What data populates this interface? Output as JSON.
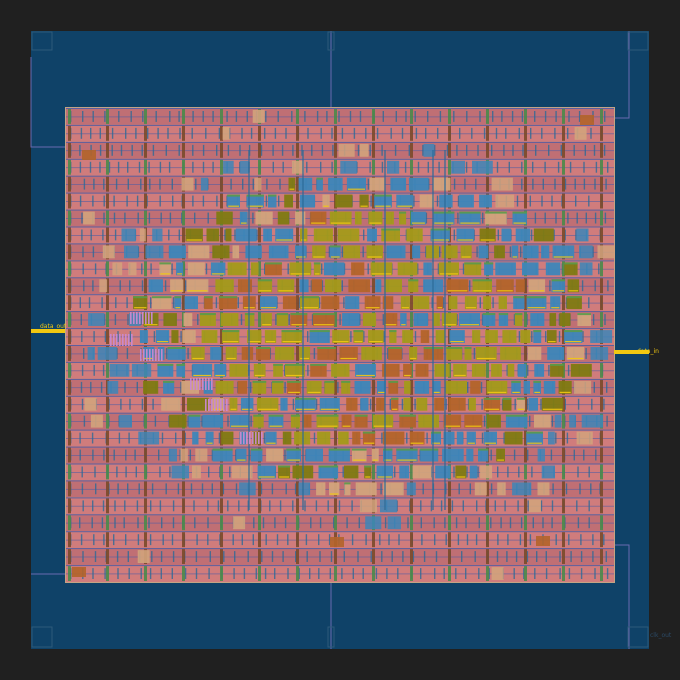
{
  "view": {
    "background": "#202020",
    "die_color": "#0f4268",
    "core_border": "#c4a484"
  },
  "colors": {
    "row_base": "#d07c7c",
    "row_base_alt": "#c06f74",
    "row_rail": "#5d5f9f",
    "metal_blue": "#3d86b9",
    "metal_blue_dark": "#2c6a97",
    "metal_olive": "#a39a1a",
    "metal_olive_dark": "#7f7a12",
    "metal_orange": "#b3642a",
    "metal_brown": "#7a4a2a",
    "metal_green": "#4a8a4a",
    "tan": "#d2a37c",
    "pink": "#c98ad0",
    "yellow": "#f2c811",
    "stripe_green": "#5a9a4a",
    "power_line": "#6a6ab0"
  },
  "pins": {
    "left": "data_out",
    "right": "data_in",
    "bottom_right": "clk_out"
  }
}
